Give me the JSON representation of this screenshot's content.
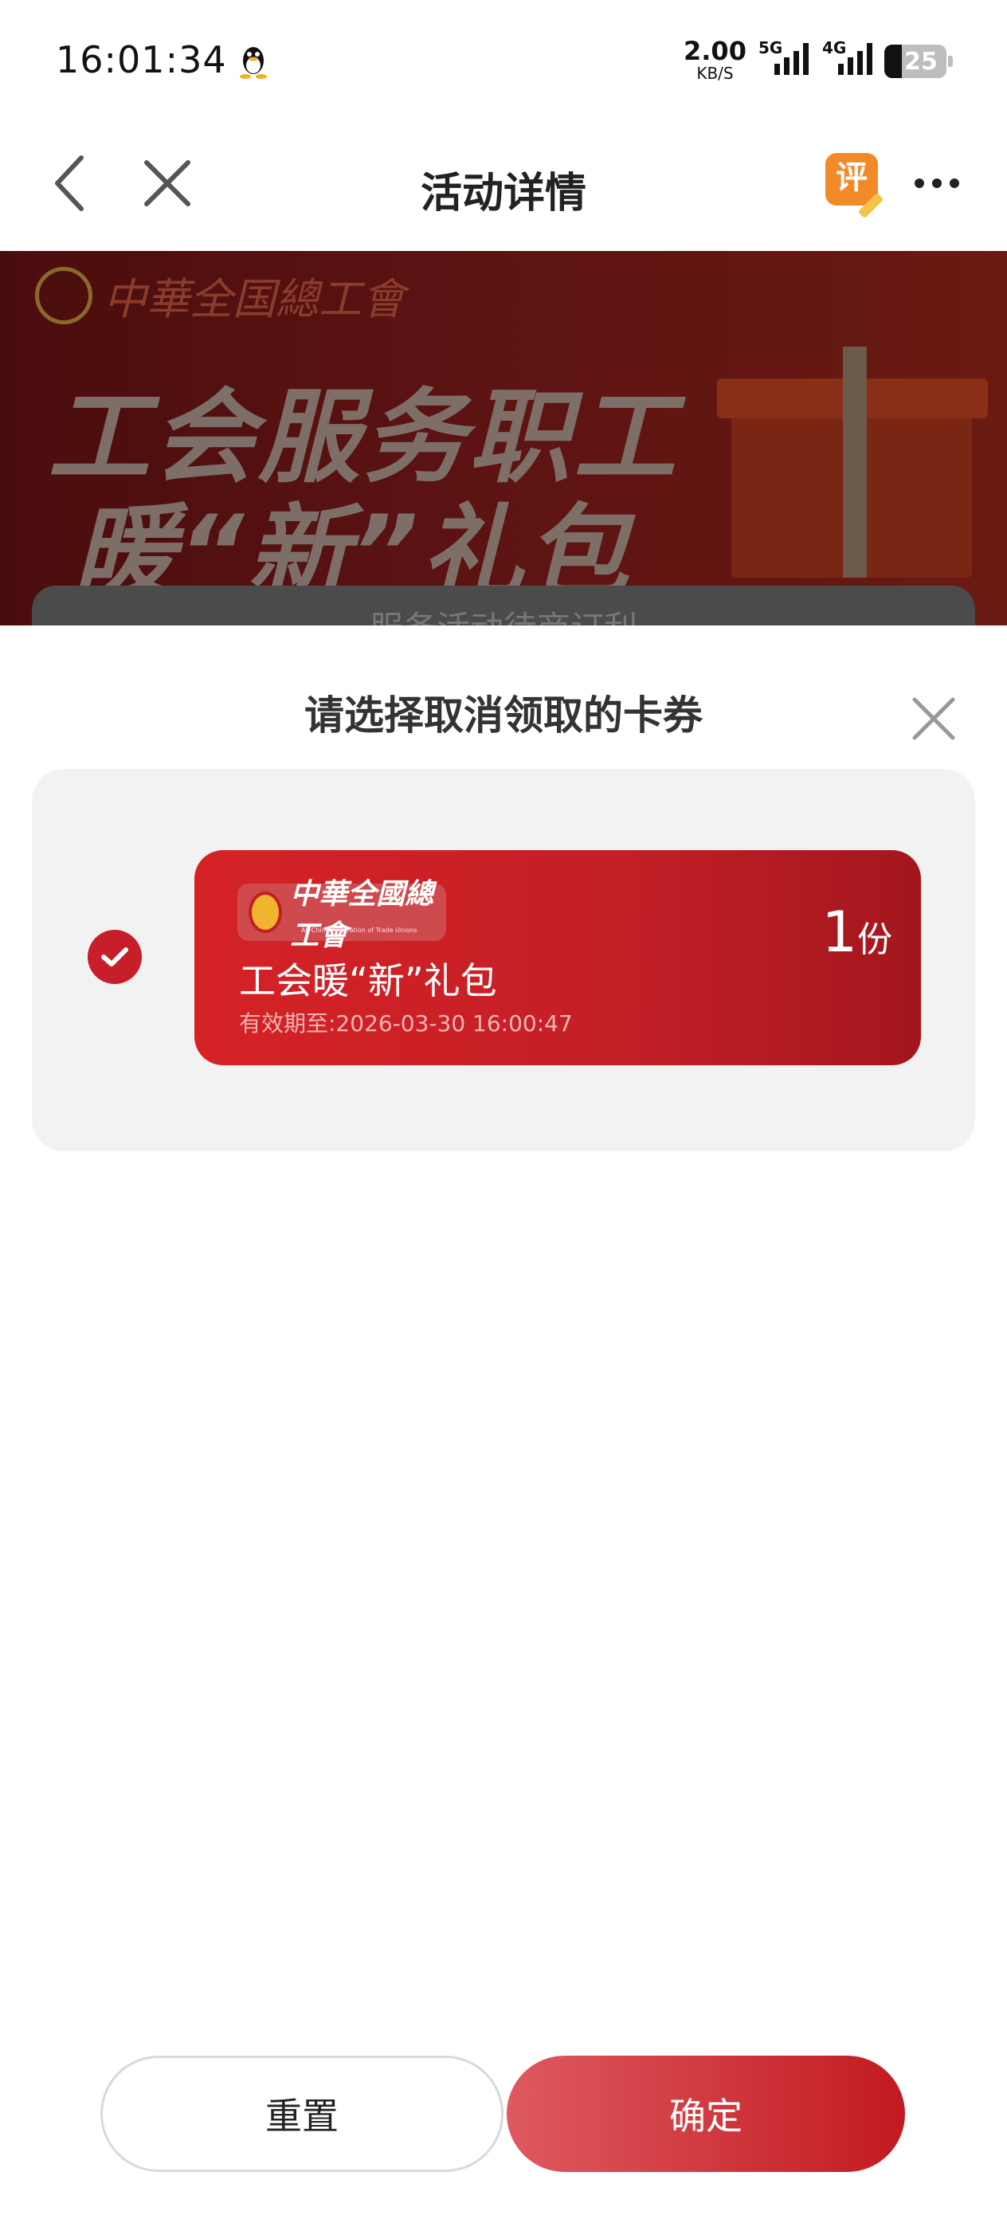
{
  "status_bar": {
    "time": "16:01:34",
    "net_speed": "2.00",
    "net_unit": "KB/S",
    "sim1": "5G",
    "sim2": "4G",
    "battery": "25"
  },
  "nav": {
    "title": "活动详情",
    "rate_label": "评"
  },
  "banner": {
    "org_name": "中華全国總工會",
    "line1": "工会服务职工",
    "line2": "暖“新”礼包",
    "card_text": "服务活动待商订利"
  },
  "sheet": {
    "title": "请选择取消领取的卡券",
    "coupons": [
      {
        "org_name": "中華全國總工會",
        "org_sub": "All-China Federation of Trade Unions",
        "name": "工会暖“新”礼包",
        "expiry": "有效期至:2026-03-30 16:00:47",
        "qty": "1",
        "qty_unit": "份",
        "selected": true
      }
    ]
  },
  "footer": {
    "reset_label": "重置",
    "confirm_label": "确定"
  },
  "colors": {
    "accent": "#c81e2a",
    "overlay": "rgba(0,0,0,0.55)",
    "sheet_bg": "#ffffff",
    "list_bg": "#f2f2f2"
  },
  "icons": {
    "back": "chevron-left-icon",
    "close_page": "close-icon",
    "more": "more-icon",
    "sheet_close": "close-icon",
    "check": "check-circle-icon",
    "qq": "qq-penguin-icon"
  }
}
